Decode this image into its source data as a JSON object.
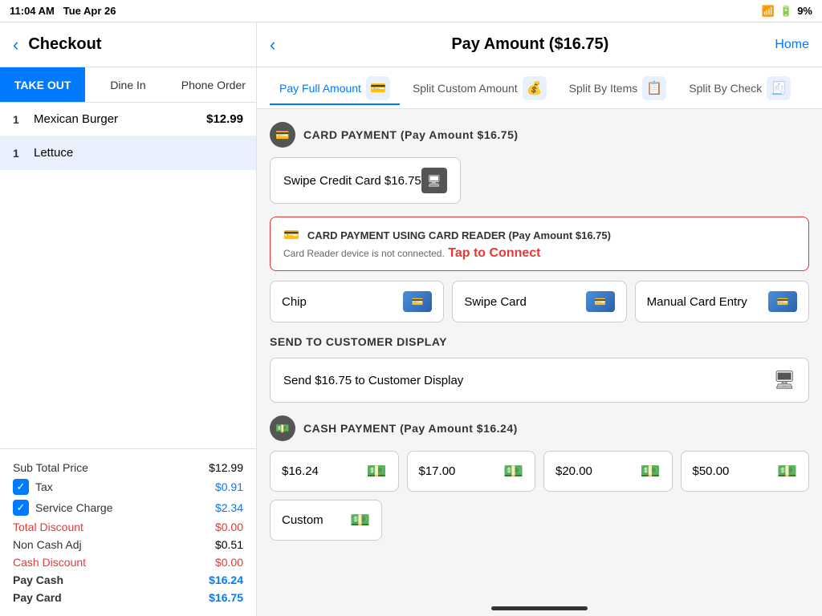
{
  "status_bar": {
    "time": "11:04 AM",
    "date": "Tue Apr 26",
    "wifi_icon": "wifi",
    "signal_icon": "signal",
    "battery": "9%"
  },
  "left_panel": {
    "back_icon": "‹",
    "title": "Checkout",
    "order_tabs": [
      {
        "id": "takeout",
        "label": "TAKE OUT",
        "active": true
      },
      {
        "id": "dinein",
        "label": "Dine In",
        "active": false
      },
      {
        "id": "phoneorder",
        "label": "Phone Order",
        "active": false
      }
    ],
    "order_items": [
      {
        "qty": "1",
        "name": "Mexican Burger",
        "price": "$12.99",
        "highlighted": false
      },
      {
        "qty": "1",
        "name": "Lettuce",
        "price": "",
        "highlighted": true
      }
    ],
    "summary": {
      "subtotal_label": "Sub Total Price",
      "subtotal_value": "$12.99",
      "tax_label": "Tax",
      "tax_value": "$0.91",
      "service_charge_label": "Service Charge",
      "service_charge_value": "$2.34",
      "total_discount_label": "Total Discount",
      "total_discount_value": "$0.00",
      "non_cash_adj_label": "Non Cash Adj",
      "non_cash_adj_value": "$0.51",
      "cash_discount_label": "Cash Discount",
      "cash_discount_value": "$0.00",
      "pay_cash_label": "Pay Cash",
      "pay_cash_value": "$16.24",
      "pay_card_label": "Pay Card",
      "pay_card_value": "$16.75"
    }
  },
  "right_panel": {
    "back_icon": "‹",
    "title": "Pay Amount ($16.75)",
    "home_label": "Home",
    "tabs": [
      {
        "id": "full",
        "label": "Pay Full Amount",
        "active": true
      },
      {
        "id": "split_custom",
        "label": "Split Custom Amount",
        "active": false
      },
      {
        "id": "split_items",
        "label": "Split By Items",
        "active": false
      },
      {
        "id": "split_check",
        "label": "Split By Check",
        "active": false
      }
    ],
    "card_payment": {
      "section_title": "CARD PAYMENT (Pay Amount $16.75)",
      "swipe_btn_label": "Swipe Credit Card $16.75"
    },
    "card_reader": {
      "section_title": "CARD PAYMENT USING CARD READER (Pay Amount $16.75)",
      "warning_text": "Card Reader device is not connected.",
      "tap_connect_text": "Tap to Connect",
      "buttons": [
        {
          "label": "Chip"
        },
        {
          "label": "Swipe Card"
        },
        {
          "label": "Manual Card Entry"
        }
      ]
    },
    "customer_display": {
      "section_title": "SEND TO CUSTOMER DISPLAY",
      "button_label": "Send $16.75 to Customer Display"
    },
    "cash_payment": {
      "section_title": "CASH PAYMENT (Pay Amount $16.24)",
      "amounts": [
        {
          "label": "$16.24"
        },
        {
          "label": "$17.00"
        },
        {
          "label": "$20.00"
        },
        {
          "label": "$50.00"
        }
      ],
      "custom_label": "Custom"
    }
  }
}
